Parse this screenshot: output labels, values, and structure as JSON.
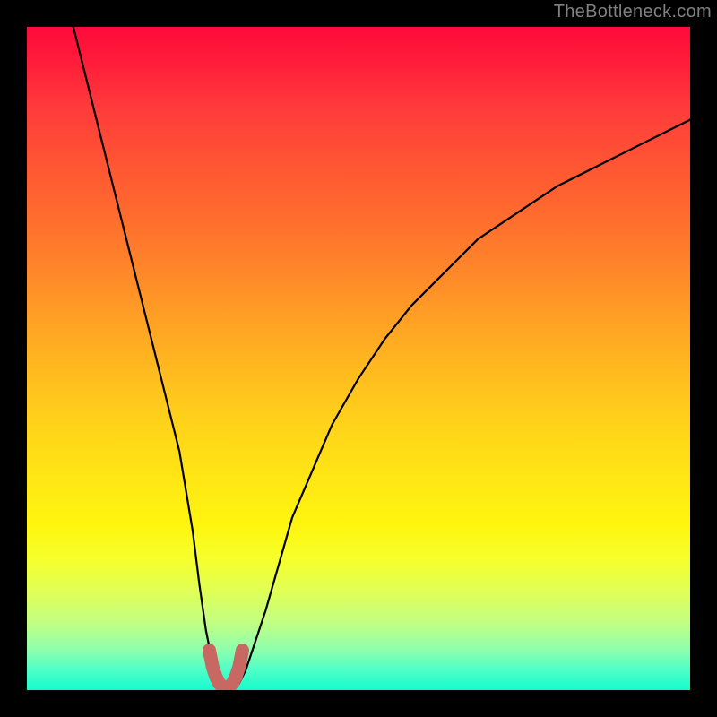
{
  "watermark": "TheBottleneck.com",
  "colors": {
    "frame": "#000000",
    "curve": "#000000",
    "marker": "#c96762",
    "watermark": "#808080",
    "gradient_top": "#ff0a3a",
    "gradient_bottom": "#15fbcd"
  },
  "chart_data": {
    "type": "line",
    "title": "",
    "xlabel": "",
    "ylabel": "",
    "xlim": [
      0,
      100
    ],
    "ylim": [
      0,
      100
    ],
    "grid": false,
    "legend": false,
    "series": [
      {
        "name": "bottleneck-curve",
        "x": [
          7,
          9,
          11,
          13,
          15,
          17,
          19,
          21,
          23,
          25,
          26,
          27,
          28,
          29,
          30,
          31,
          32,
          33,
          34,
          36,
          38,
          40,
          43,
          46,
          50,
          54,
          58,
          63,
          68,
          74,
          80,
          86,
          92,
          100
        ],
        "y": [
          100,
          92,
          84,
          76,
          68,
          60,
          52,
          44,
          36,
          24,
          16,
          9,
          4,
          1,
          0,
          0,
          1,
          3,
          6,
          12,
          19,
          26,
          33,
          40,
          47,
          53,
          58,
          63,
          68,
          72,
          76,
          79,
          82,
          86
        ]
      },
      {
        "name": "optimal-marker",
        "x": [
          27.5,
          28,
          28.5,
          29,
          29.5,
          30,
          30.5,
          31,
          31.5,
          32,
          32.5
        ],
        "y": [
          6,
          3.5,
          2,
          1,
          0.5,
          0.3,
          0.5,
          1,
          2,
          3.5,
          6
        ]
      }
    ],
    "annotations": []
  }
}
